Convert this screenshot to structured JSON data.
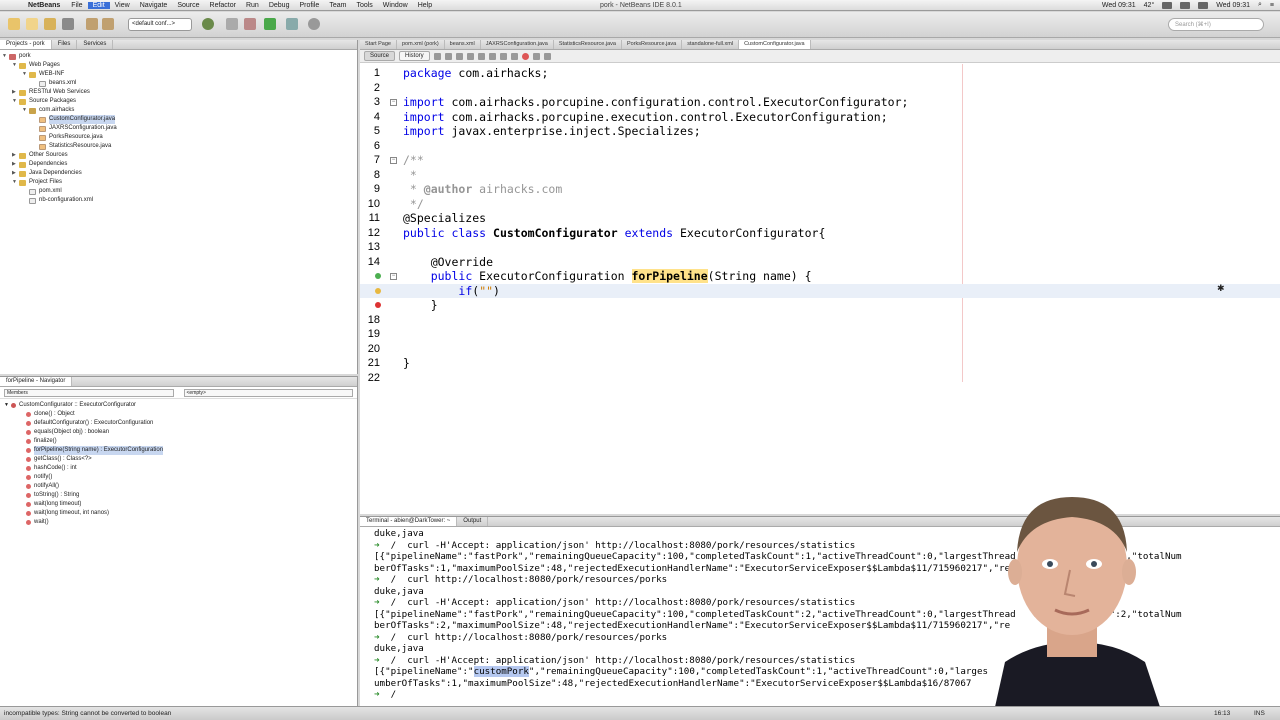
{
  "menubar": {
    "app_name": "NetBeans",
    "menus": [
      "File",
      "Edit",
      "View",
      "Navigate",
      "Source",
      "Refactor",
      "Run",
      "Debug",
      "Profile",
      "Team",
      "Tools",
      "Window",
      "Help"
    ],
    "active_menu": "Edit",
    "window_title": "pork - NetBeans IDE 8.0.1",
    "clock_left": "Wed 09:31",
    "temp": "42°",
    "clock_right": "Wed 09:31"
  },
  "toolbar": {
    "config_select": "<default conf...>",
    "search_placeholder": "Search (⌘+I)"
  },
  "projects_panel": {
    "tabs": [
      "Projects - pork",
      "Files",
      "Services"
    ],
    "tree": [
      {
        "label": "pork",
        "depth": 0,
        "icon": "proj",
        "twist": "▼"
      },
      {
        "label": "Web Pages",
        "depth": 1,
        "icon": "folder",
        "twist": "▼"
      },
      {
        "label": "WEB-INF",
        "depth": 2,
        "icon": "folder",
        "twist": "▼"
      },
      {
        "label": "beans.xml",
        "depth": 3,
        "icon": "xml",
        "twist": ""
      },
      {
        "label": "RESTful Web Services",
        "depth": 1,
        "icon": "folder",
        "twist": "▶"
      },
      {
        "label": "Source Packages",
        "depth": 1,
        "icon": "folder",
        "twist": "▼"
      },
      {
        "label": "com.airhacks",
        "depth": 2,
        "icon": "pkg",
        "twist": "▼"
      },
      {
        "label": "CustomConfigurator.java",
        "depth": 3,
        "icon": "java",
        "twist": "",
        "selected": true
      },
      {
        "label": "JAXRSConfiguration.java",
        "depth": 3,
        "icon": "java",
        "twist": ""
      },
      {
        "label": "PorksResource.java",
        "depth": 3,
        "icon": "java",
        "twist": ""
      },
      {
        "label": "StatisticsResource.java",
        "depth": 3,
        "icon": "java",
        "twist": ""
      },
      {
        "label": "Other Sources",
        "depth": 1,
        "icon": "folder",
        "twist": "▶"
      },
      {
        "label": "Dependencies",
        "depth": 1,
        "icon": "folder",
        "twist": "▶"
      },
      {
        "label": "Java Dependencies",
        "depth": 1,
        "icon": "folder",
        "twist": "▶"
      },
      {
        "label": "Project Files",
        "depth": 1,
        "icon": "folder",
        "twist": "▼"
      },
      {
        "label": "pom.xml",
        "depth": 2,
        "icon": "xml",
        "twist": ""
      },
      {
        "label": "nb-configuration.xml",
        "depth": 2,
        "icon": "xml",
        "twist": ""
      }
    ]
  },
  "navigator": {
    "title": "forPipeline - Navigator",
    "filter_label": "Members",
    "filter_empty": "<empty>",
    "root": "CustomConfigurator :: ExecutorConfigurator",
    "members": [
      {
        "label": "clone() : Object",
        "selected": false
      },
      {
        "label": "defaultConfigurator() : ExecutorConfiguration",
        "selected": false
      },
      {
        "label": "equals(Object obj) : boolean",
        "selected": false
      },
      {
        "label": "finalize()",
        "selected": false
      },
      {
        "label": "forPipeline(String name) : ExecutorConfiguration",
        "selected": true
      },
      {
        "label": "getClass() : Class<?>",
        "selected": false
      },
      {
        "label": "hashCode() : int",
        "selected": false
      },
      {
        "label": "notify()",
        "selected": false
      },
      {
        "label": "notifyAll()",
        "selected": false
      },
      {
        "label": "toString() : String",
        "selected": false
      },
      {
        "label": "wait(long timeout)",
        "selected": false
      },
      {
        "label": "wait(long timeout, int nanos)",
        "selected": false
      },
      {
        "label": "wait()",
        "selected": false
      }
    ]
  },
  "editor": {
    "tabs": [
      "Start Page",
      "pom.xml (pork)",
      "beans.xml",
      "JAXRSConfiguration.java",
      "StatisticsResource.java",
      "PorksResource.java",
      "standalone-full.xml",
      "CustomConfigurator.java"
    ],
    "active_tab": "CustomConfigurator.java",
    "source_label": "Source",
    "history_label": "History",
    "line_numbers": [
      "1",
      "2",
      "3",
      "4",
      "5",
      "6",
      "7",
      "8",
      "9",
      "10",
      "11",
      "12",
      "13",
      "14",
      "",
      "",
      "",
      "18",
      "19",
      "20",
      "21",
      "22"
    ],
    "current_line_index": 15
  },
  "terminal": {
    "tabs": [
      "Terminal - abien@DarkTower: ~",
      "Output"
    ],
    "lines": [
      "duke,java",
      "➜  /  curl -H'Accept: application/json' http://localhost:8080/pork/resources/statistics",
      "[{\"pipelineName\":\"fastPork\",\"remainingQueueCapacity\":100,\"completedTaskCount\":1,\"activeThreadCount\":0,\"largestThread   ThreadPoolSize\":1,\"totalNum",
      "berOfTasks\":1,\"maximumPoolSize\":48,\"rejectedExecutionHandlerName\":\"ExecutorServiceExposer$$Lambda$11/715960217\",\"re",
      "➜  /  curl http://localhost:8080/pork/resources/porks",
      "duke,java",
      "➜  /  curl -H'Accept: application/json' http://localhost:8080/pork/resources/statistics",
      "[{\"pipelineName\":\"fastPork\",\"remainingQueueCapacity\":100,\"completedTaskCount\":2,\"activeThreadCount\":0,\"largestThread   ThreadPoolSize\":2,\"totalNum",
      "berOfTasks\":2,\"maximumPoolSize\":48,\"rejectedExecutionHandlerName\":\"ExecutorServiceExposer$$Lambda$11/715960217\",\"re",
      "➜  /  curl http://localhost:8080/pork/resources/porks",
      "duke,java",
      "➜  /  curl -H'Accept: application/json' http://localhost:8080/pork/resources/statistics",
      "[{\"pipelineName\":\"customPork\",\"remainingQueueCapacity\":100,\"completedTaskCount\":1,\"activeThreadCount\":0,\"larges     readPoolSize\":1,\"totalN",
      "umberOfTasks\":1,\"maximumPoolSize\":48,\"rejectedExecutionHandlerName\":\"ExecutorServiceExposer$$Lambda$16/87067",
      "➜  /  "
    ],
    "highlight": "customPork"
  },
  "statusbar": {
    "message": "incompatible types: String cannot be converted to boolean",
    "position": "16:13",
    "mode": "INS"
  },
  "colors": {
    "keyword": "#0000e6",
    "comment": "#969696",
    "method_highlight": "#ffe28a",
    "selection": "#c8d7f0"
  }
}
